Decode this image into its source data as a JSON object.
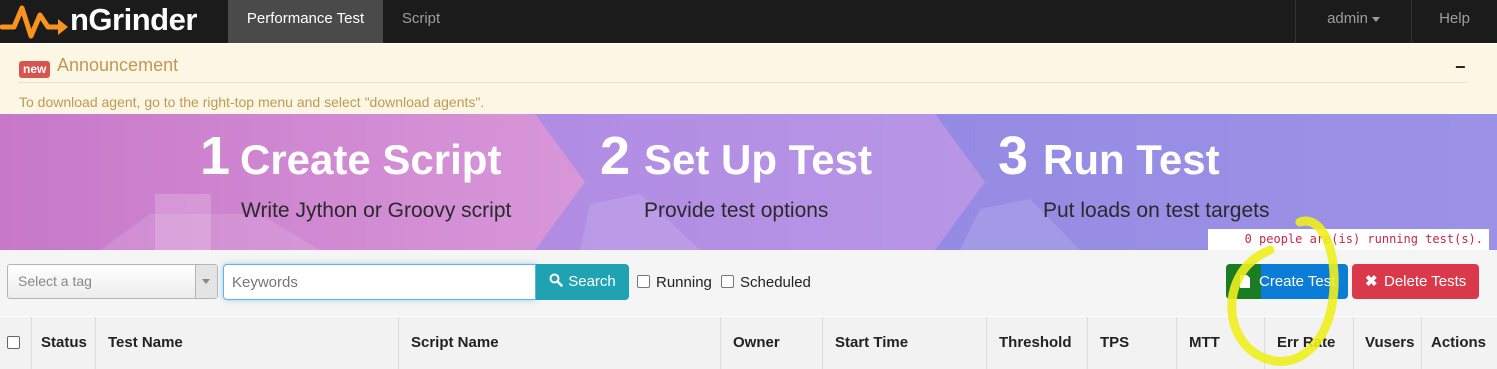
{
  "navbar": {
    "brand": "nGrinder",
    "tabs": [
      {
        "label": "Performance Test",
        "active": true
      },
      {
        "label": "Script",
        "active": false
      }
    ],
    "user_menu": "admin",
    "help": "Help"
  },
  "announcement": {
    "badge": "new",
    "title": "Announcement",
    "collapse": "−",
    "text": "To download agent, go to the right-top menu and select \"download agents\"."
  },
  "banner": {
    "steps": [
      {
        "number": "1",
        "title": "Create Script",
        "subtitle": "Write Jython or Groovy script"
      },
      {
        "number": "2",
        "title": "Set Up Test",
        "subtitle": "Provide test options"
      },
      {
        "number": "3",
        "title": "Run Test",
        "subtitle": "Put loads on test targets"
      }
    ],
    "running_message": "0 people are(is) running test(s)."
  },
  "toolbar": {
    "tag_select_placeholder": "Select a tag",
    "keywords_placeholder": "Keywords",
    "search_label": "Search",
    "filters": [
      {
        "label": "Running",
        "checked": false
      },
      {
        "label": "Scheduled",
        "checked": false
      }
    ],
    "create_test_label": "Create Test",
    "delete_tests_label": "Delete Tests"
  },
  "table": {
    "columns": [
      "Status",
      "Test Name",
      "Script Name",
      "Owner",
      "Start Time",
      "Threshold",
      "TPS",
      "MTT",
      "Err Rate",
      "Vusers",
      "Actions"
    ]
  },
  "colors": {
    "navbar_bg": "#1b1b1b",
    "brand_orange": "#f7931e",
    "announcement_bg": "#fcf7e5",
    "search_btn": "#1fa3b3",
    "create_btn": "#0b7dd6",
    "delete_btn": "#d9394a",
    "highlight_annotation": "#eef01e"
  }
}
